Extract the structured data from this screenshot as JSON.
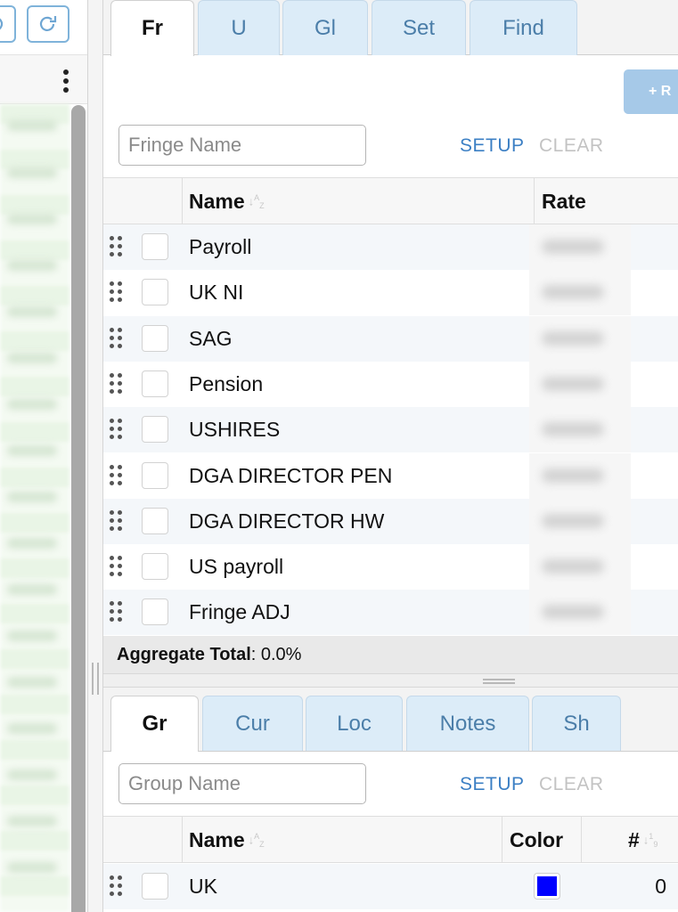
{
  "toolbar": {
    "undo_icon": "undo-icon",
    "redo_icon": "redo-icon",
    "more_icon": "kebab-icon"
  },
  "fringes_panel": {
    "tabs": [
      {
        "label": "Fr",
        "active": true
      },
      {
        "label": "U",
        "active": false
      },
      {
        "label": "Gl",
        "active": false
      },
      {
        "label": "Set",
        "active": false
      },
      {
        "label": "Find",
        "active": false
      }
    ],
    "add_button_label": "+ R",
    "search_placeholder": "Fringe Name",
    "setup_label": "SETUP",
    "clear_label": "CLEAR",
    "columns": {
      "name": "Name",
      "rate": "Rate"
    },
    "rows": [
      {
        "name": "Payroll"
      },
      {
        "name": "UK NI"
      },
      {
        "name": "SAG"
      },
      {
        "name": "Pension"
      },
      {
        "name": "USHIRES"
      },
      {
        "name": "DGA DIRECTOR PEN"
      },
      {
        "name": "DGA DIRECTOR HW"
      },
      {
        "name": "US payroll"
      },
      {
        "name": "Fringe ADJ"
      }
    ],
    "aggregate_label": "Aggregate Total",
    "aggregate_value": ": 0.0%"
  },
  "groups_panel": {
    "tabs": [
      {
        "label": "Gr",
        "active": true
      },
      {
        "label": "Cur",
        "active": false
      },
      {
        "label": "Loc",
        "active": false
      },
      {
        "label": "Notes",
        "active": false
      },
      {
        "label": "Sh",
        "active": false
      }
    ],
    "search_placeholder": "Group Name",
    "setup_label": "SETUP",
    "clear_label": "CLEAR",
    "columns": {
      "name": "Name",
      "color": "Color",
      "count": "#"
    },
    "rows": [
      {
        "name": "UK",
        "color": "#0000ff",
        "count": "0"
      }
    ]
  }
}
